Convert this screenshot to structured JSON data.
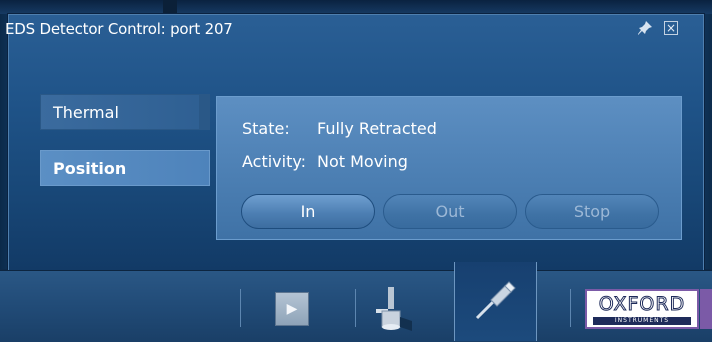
{
  "window": {
    "title": "EDS Detector Control: port 207"
  },
  "tabs": [
    {
      "label": "Thermal",
      "selected": false
    },
    {
      "label": "Position",
      "selected": true
    }
  ],
  "status": {
    "state_label": "State:",
    "state_value": "Fully Retracted",
    "activity_label": "Activity:",
    "activity_value": "Not Moving"
  },
  "buttons": {
    "in": "In",
    "out": "Out",
    "stop": "Stop"
  },
  "toolbar": {
    "play_icon": "play-icon",
    "logo": {
      "main": "OXFORD",
      "sub": "INSTRUMENTS"
    }
  },
  "colors": {
    "accent": "#4f82b6",
    "logo_border": "#7b5aa7"
  }
}
